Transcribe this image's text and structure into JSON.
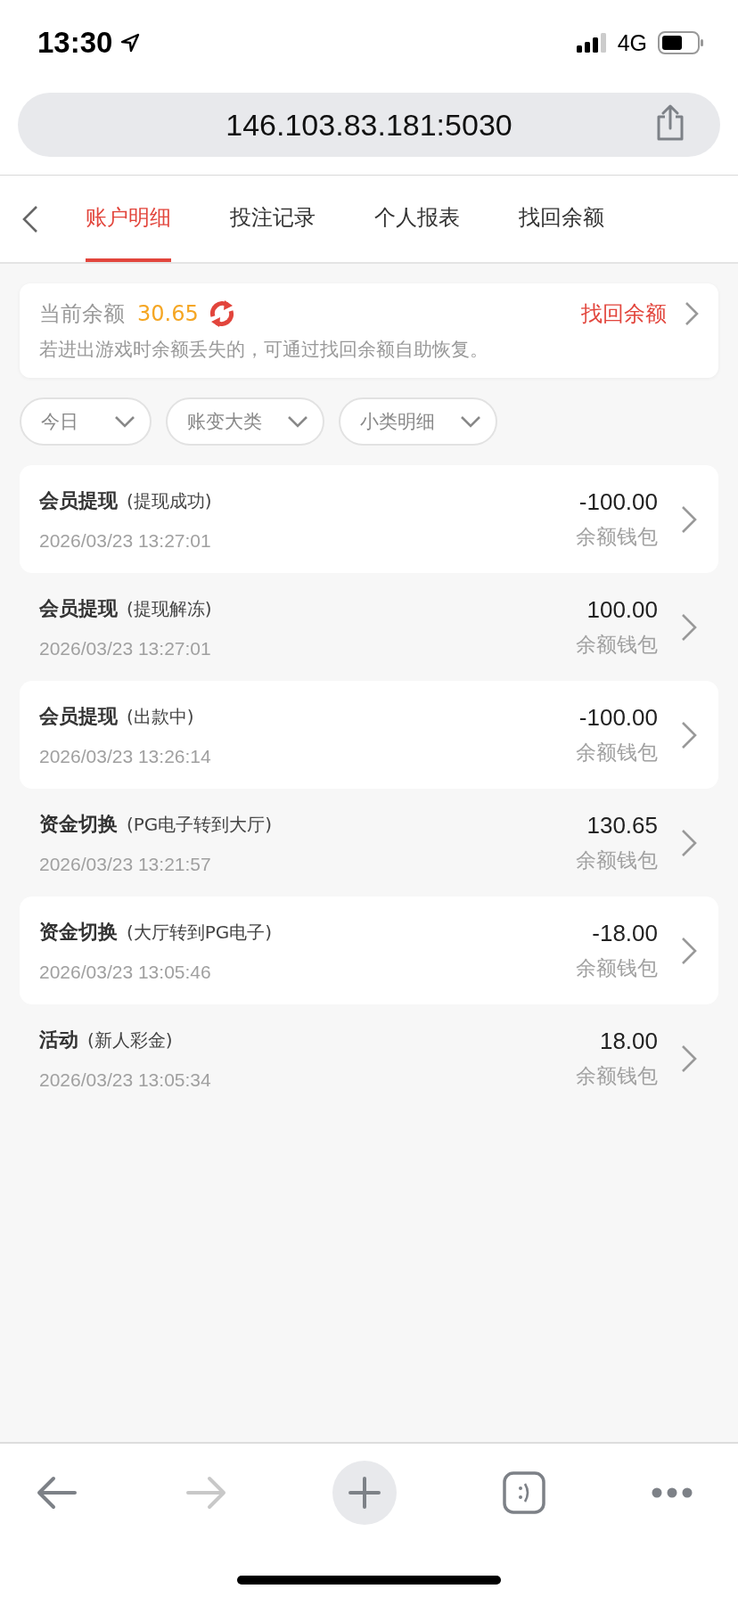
{
  "status_bar": {
    "time": "13:30",
    "network": "4G"
  },
  "address_bar": {
    "url": "146.103.83.181:5030"
  },
  "tabs": [
    {
      "label": "账户明细",
      "selected": true
    },
    {
      "label": "投注记录",
      "selected": false
    },
    {
      "label": "个人报表",
      "selected": false
    },
    {
      "label": "找回余额",
      "selected": false
    }
  ],
  "balance_card": {
    "label": "当前余额",
    "amount": "30.65",
    "recover_link": "找回余额",
    "hint": "若进出游戏时余额丢失的，可通过找回余额自助恢复。"
  },
  "filters": [
    {
      "label": "今日"
    },
    {
      "label": "账变大类"
    },
    {
      "label": "小类明细"
    }
  ],
  "records": [
    {
      "title": "会员提现",
      "note": "(提现成功)",
      "time": "2026/03/23 13:27:01",
      "amount": "-100.00",
      "wallet": "余额钱包"
    },
    {
      "title": "会员提现",
      "note": "(提现解冻)",
      "time": "2026/03/23 13:27:01",
      "amount": "100.00",
      "wallet": "余额钱包"
    },
    {
      "title": "会员提现",
      "note": "(出款中)",
      "time": "2026/03/23 13:26:14",
      "amount": "-100.00",
      "wallet": "余额钱包"
    },
    {
      "title": "资金切换",
      "note": "(PG电子转到大厅)",
      "time": "2026/03/23 13:21:57",
      "amount": "130.65",
      "wallet": "余额钱包"
    },
    {
      "title": "资金切换",
      "note": "(大厅转到PG电子)",
      "time": "2026/03/23 13:05:46",
      "amount": "-18.00",
      "wallet": "余额钱包"
    },
    {
      "title": "活动",
      "note": "(新人彩金)",
      "time": "2026/03/23 13:05:34",
      "amount": "18.00",
      "wallet": "余额钱包"
    }
  ],
  "toolbar": [
    {
      "kind": "back",
      "disabled": false
    },
    {
      "kind": "forward",
      "disabled": true
    },
    {
      "kind": "new-tab",
      "disabled": false
    },
    {
      "kind": "tabs",
      "disabled": false
    },
    {
      "kind": "more",
      "disabled": false
    }
  ]
}
